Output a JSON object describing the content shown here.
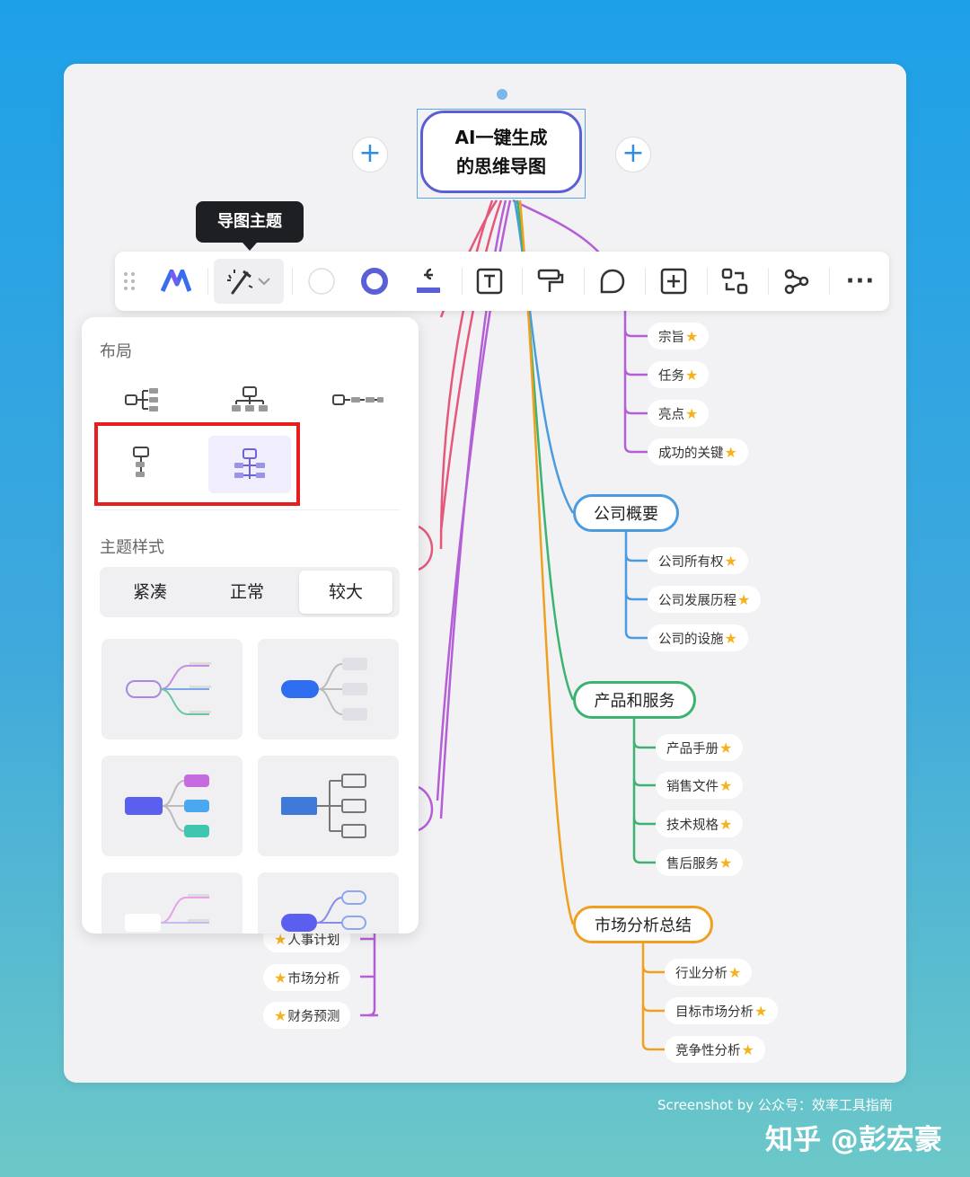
{
  "root": {
    "line1": "AI一键生成",
    "line2": "的思维导图"
  },
  "plus_glyph": "+",
  "tooltip": "导图主题",
  "toolbar": {
    "more_glyph": "···"
  },
  "panel": {
    "layout_title": "布局",
    "style_title": "主题样式",
    "sizes": [
      "紧凑",
      "正常",
      "较大"
    ],
    "active_size": "较大"
  },
  "branches": [
    {
      "label": "公司概要",
      "color": "#4a9be0",
      "leaves": [
        "公司所有权",
        "公司发展历程",
        "公司的设施"
      ]
    },
    {
      "label": "产品和服务",
      "color": "#3cb371",
      "leaves": [
        "产品手册",
        "销售文件",
        "技术规格",
        "售后服务"
      ]
    },
    {
      "label": "市场分析总结",
      "color": "#f0a020",
      "leaves": [
        "行业分析",
        "目标市场分析",
        "竞争性分析"
      ]
    }
  ],
  "top_leaves": [
    "宗旨",
    "任务",
    "亮点",
    "成功的关键"
  ],
  "left_leaves": [
    "人事计划",
    "市场分析",
    "财务预测"
  ],
  "star_glyph": "★",
  "footer": "Screenshot by 公众号：效率工具指南",
  "watermark": "知乎 @彭宏豪",
  "colors": {
    "accent": "#5b5fd6",
    "highlight": "#e81e1e",
    "purple": "#b45fd6",
    "pink": "#e4587a",
    "star": "#f5b21c"
  }
}
